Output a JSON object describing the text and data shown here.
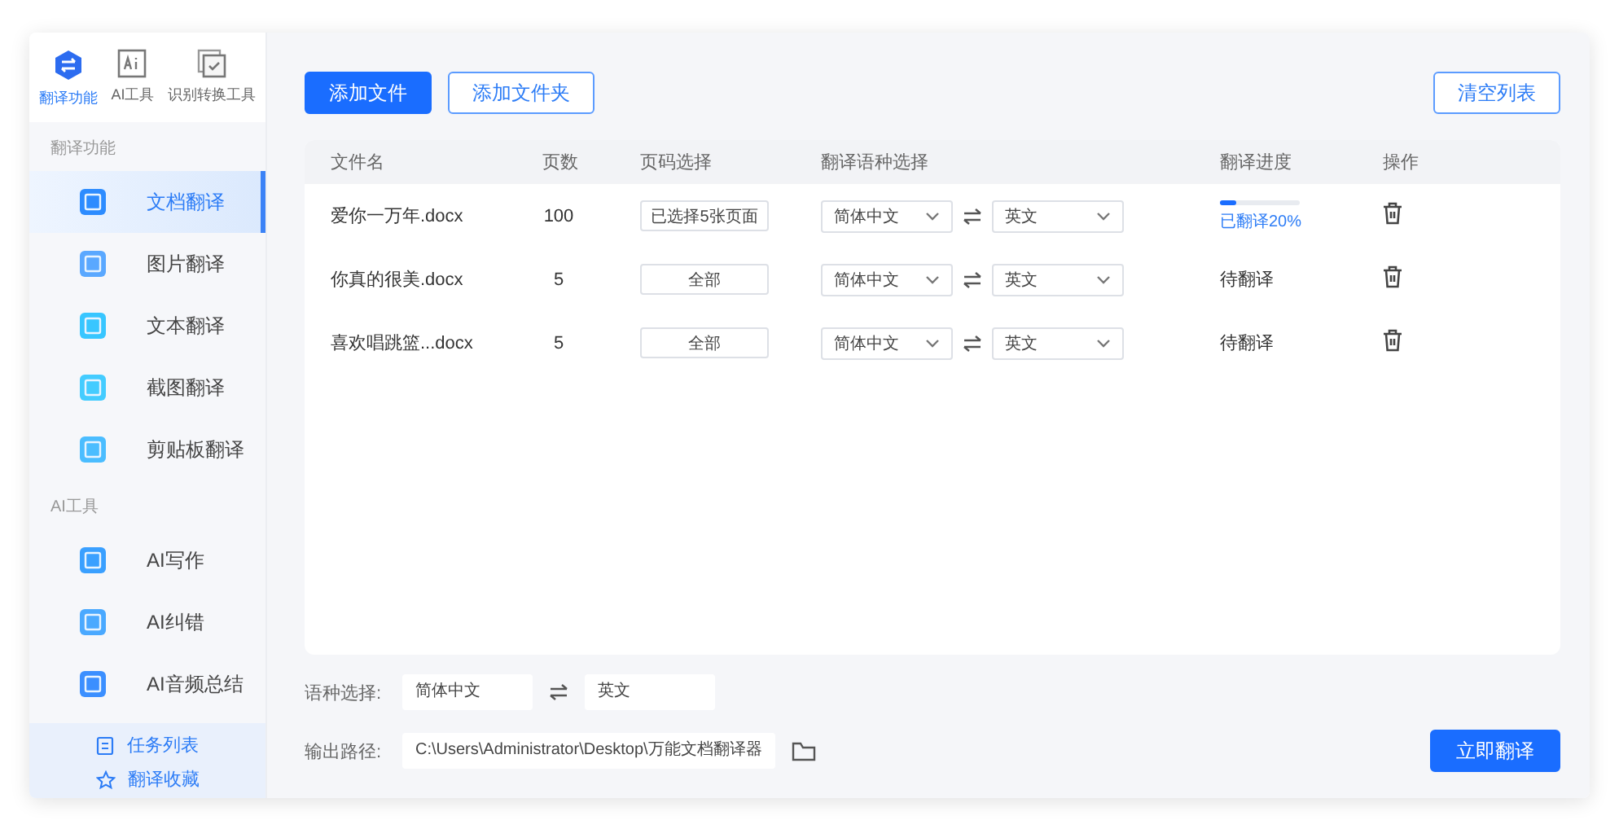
{
  "nav_tabs": [
    {
      "label": "翻译功能",
      "selected": true
    },
    {
      "label": "AI工具",
      "selected": false
    },
    {
      "label": "识别转换工具",
      "selected": false
    }
  ],
  "sections": [
    {
      "title": "翻译功能",
      "items": [
        {
          "label": "文档翻译",
          "selected": true
        },
        {
          "label": "图片翻译",
          "selected": false
        },
        {
          "label": "文本翻译",
          "selected": false
        },
        {
          "label": "截图翻译",
          "selected": false
        },
        {
          "label": "剪贴板翻译",
          "selected": false
        }
      ]
    },
    {
      "title": "AI工具",
      "items": [
        {
          "label": "AI写作",
          "selected": false
        },
        {
          "label": "AI纠错",
          "selected": false
        },
        {
          "label": "AI音频总结",
          "selected": false
        }
      ]
    }
  ],
  "footer_links": [
    "任务列表",
    "翻译收藏"
  ],
  "toolbar": {
    "add_file": "添加文件",
    "add_folder": "添加文件夹",
    "clear_list": "清空列表"
  },
  "table": {
    "columns": [
      "文件名",
      "页数",
      "页码选择",
      "翻译语种选择",
      "翻译进度",
      "操作"
    ],
    "rows": [
      {
        "file": "爱你一万年.docx",
        "pages": "100",
        "page_selection": "已选择5张页面",
        "source_lang": "简体中文",
        "target_lang": "英文",
        "progress": {
          "kind": "bar",
          "level": 0.2,
          "text": "已翻译20%"
        }
      },
      {
        "file": "你真的很美.docx",
        "pages": "5",
        "page_selection": "全部",
        "source_lang": "简体中文",
        "target_lang": "英文",
        "progress": {
          "kind": "status",
          "text": "待翻译"
        }
      },
      {
        "file": "喜欢唱跳篮...docx",
        "pages": "5",
        "page_selection": "全部",
        "source_lang": "简体中文",
        "target_lang": "英文",
        "progress": {
          "kind": "status",
          "text": "待翻译"
        }
      }
    ]
  },
  "language": {
    "label": "语种选择:",
    "source": "简体中文",
    "target": "英文"
  },
  "output": {
    "label": "输出路径:",
    "path": "C:\\Users\\Administrator\\Desktop\\万能文档翻译器"
  },
  "translate_button": "立即翻译"
}
